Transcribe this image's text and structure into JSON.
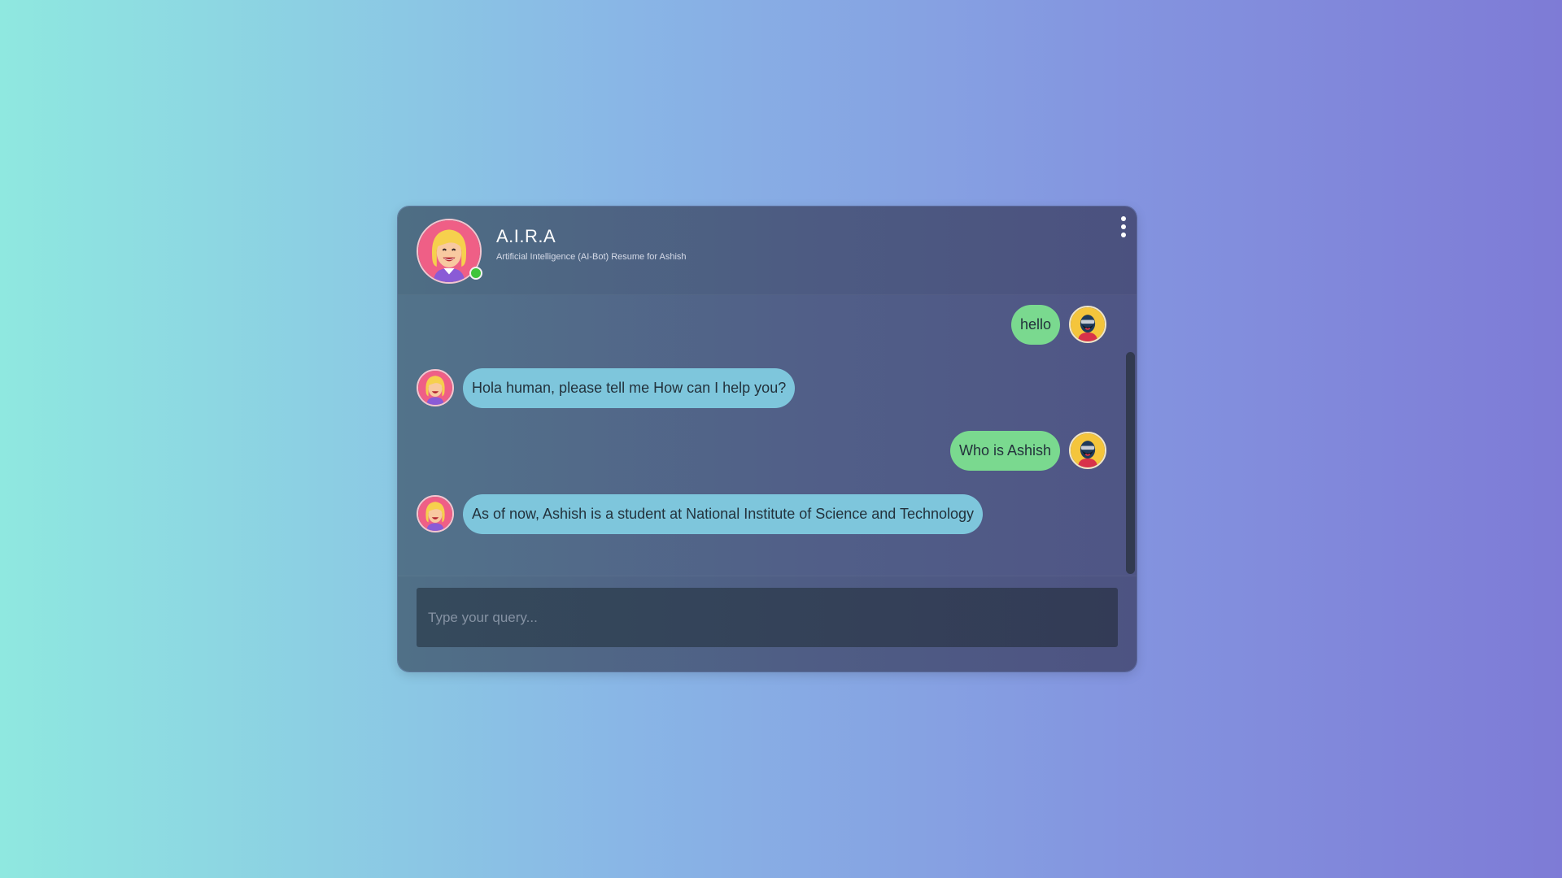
{
  "header": {
    "title": "A.I.R.A",
    "subtitle": "Artificial Intelligence (AI-Bot) Resume for Ashish",
    "status": "online",
    "menu_icon": "more-vertical-icon"
  },
  "messages": [
    {
      "sender": "user",
      "text": "hello"
    },
    {
      "sender": "bot",
      "text": "Hola human, please tell me How can I help you?"
    },
    {
      "sender": "user",
      "text": "Who is Ashish"
    },
    {
      "sender": "bot",
      "text": "As of now, Ashish is a student at National Institute of Science and Technology"
    }
  ],
  "input": {
    "placeholder": "Type your query...",
    "value": ""
  },
  "colors": {
    "user_bubble": "#7ad98f",
    "bot_bubble": "#7ec6dc",
    "online": "#3fc53a"
  }
}
